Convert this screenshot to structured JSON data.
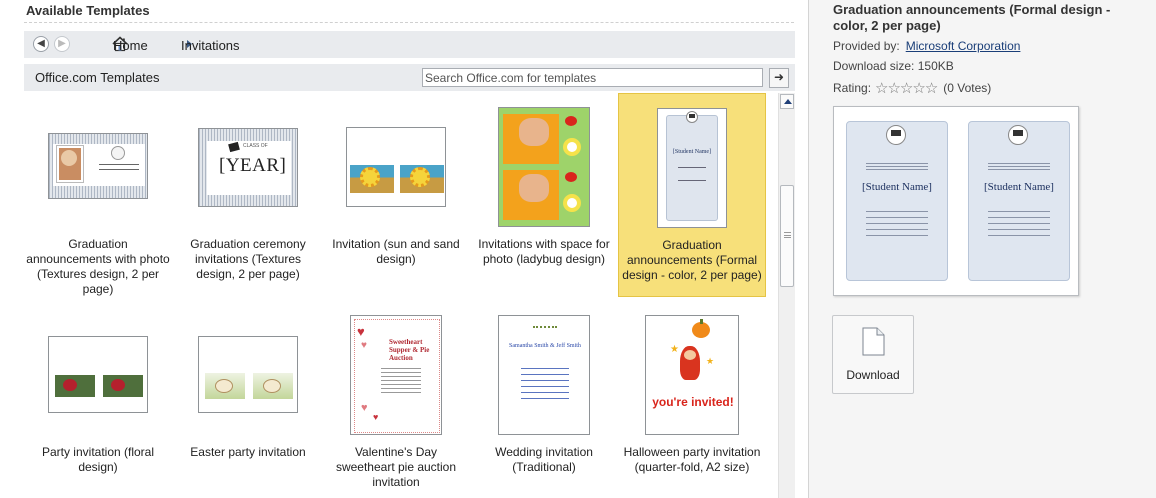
{
  "left": {
    "section_title": "Available Templates",
    "nav": {
      "back_label": "◀",
      "forward_label": "▶",
      "home_label": "Home",
      "current_label": "Invitations"
    },
    "toolbar": {
      "title": "Office.com Templates",
      "search_placeholder": "Search Office.com for templates",
      "search_button_label": "➜"
    },
    "templates": [
      {
        "label": "Graduation announcements with photo (Textures design, 2 per page)",
        "thumb_icon": "graduation-photo-card-thumbnail",
        "selected": false
      },
      {
        "label": "Graduation ceremony invitations (Textures design, 2 per page)",
        "thumb_icon": "graduation-ceremony-card-thumbnail",
        "selected": false,
        "thumb_text": {
          "line1": "CLASS OF",
          "line2": "[YEAR]"
        }
      },
      {
        "label": "Invitation (sun and sand design)",
        "thumb_icon": "sun-and-sand-card-thumbnail",
        "selected": false
      },
      {
        "label": "Invitations with space for photo (ladybug design)",
        "thumb_icon": "ladybug-card-thumbnail",
        "selected": false
      },
      {
        "label": "Graduation announcements (Formal design - color, 2 per page)",
        "thumb_icon": "formal-graduation-card-thumbnail",
        "selected": true,
        "thumb_text": {
          "name": "[Student Name]"
        }
      },
      {
        "label": "Party invitation (floral design)",
        "thumb_icon": "floral-party-card-thumbnail",
        "selected": false
      },
      {
        "label": "Easter party invitation",
        "thumb_icon": "easter-party-card-thumbnail",
        "selected": false
      },
      {
        "label": "Valentine's Day sweetheart pie auction invitation",
        "thumb_icon": "valentine-hearts-card-thumbnail",
        "selected": false,
        "thumb_text": {
          "heading": "Sweetheart Supper & Pie Auction"
        }
      },
      {
        "label": "Wedding invitation (Traditional)",
        "thumb_icon": "wedding-card-thumbnail",
        "selected": false,
        "thumb_text": {
          "names": "Samantha Smith & Jeff Smith"
        }
      },
      {
        "label": "Halloween party invitation (quarter-fold, A2 size)",
        "thumb_icon": "halloween-pumpkin-card-thumbnail",
        "selected": false,
        "thumb_text": {
          "invite": "you're invited!"
        }
      }
    ]
  },
  "detail": {
    "title": "Graduation announcements (Formal design - color, 2 per page)",
    "provided_by_label": "Provided by:",
    "provider": "Microsoft Corporation",
    "download_size_label": "Download size:",
    "download_size": "150KB",
    "rating_label": "Rating:",
    "rating_stars": "☆☆☆☆☆",
    "rating_value": 0,
    "votes": "(0 Votes)",
    "preview_name_text": "[Student Name]",
    "download_label": "Download"
  },
  "colors": {
    "selected_tile": "#f7e07a",
    "link": "#1a3e78",
    "bar_background": "#e9ebee"
  }
}
